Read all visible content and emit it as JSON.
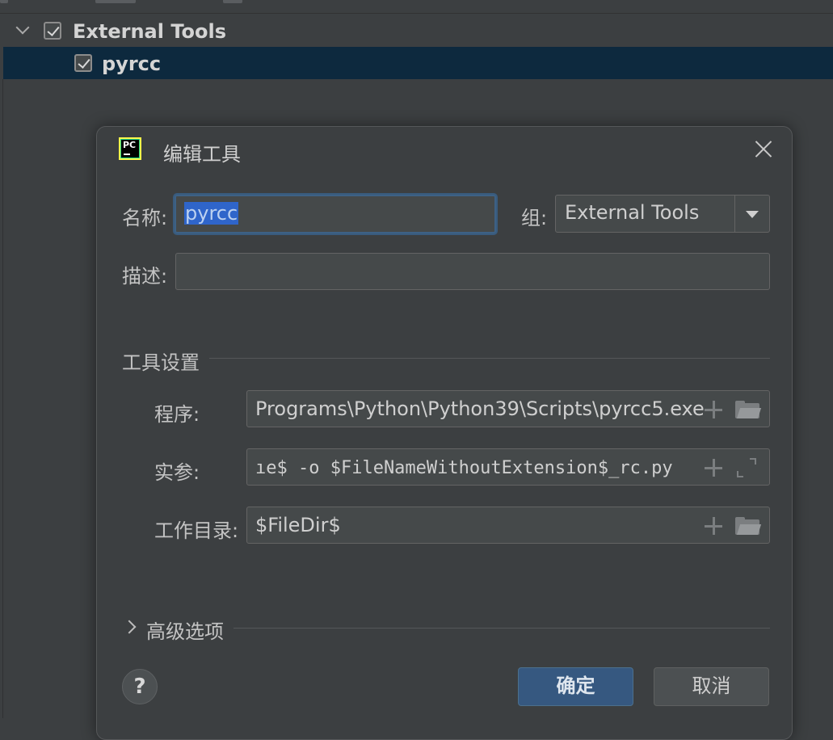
{
  "tree": {
    "group_label": "External Tools",
    "group_checked": true,
    "item_label": "pyrcc",
    "item_checked": true
  },
  "dialog": {
    "title": "编辑工具",
    "app_icon_text": "PC",
    "name_label": "名称:",
    "name_value": "pyrcc",
    "group_label": "组:",
    "group_value": "External Tools",
    "description_label": "描述:",
    "description_value": "",
    "tool_settings_title": "工具设置",
    "program_label": "程序:",
    "program_value": "Programs\\Python\\Python39\\Scripts\\pyrcc5.exe",
    "args_label": "实参:",
    "args_value": "ıe$ -o $FileNameWithoutExtension$_rc.py",
    "workdir_label": "工作目录:",
    "workdir_value": "$FileDir$",
    "advanced_label": "高级选项",
    "help_label": "?",
    "ok_label": "确定",
    "cancel_label": "取消"
  },
  "colors": {
    "background": "#3c3f41",
    "selection_row": "#0d293e",
    "primary_button": "#365880",
    "text_selection": "#2f65ca"
  }
}
